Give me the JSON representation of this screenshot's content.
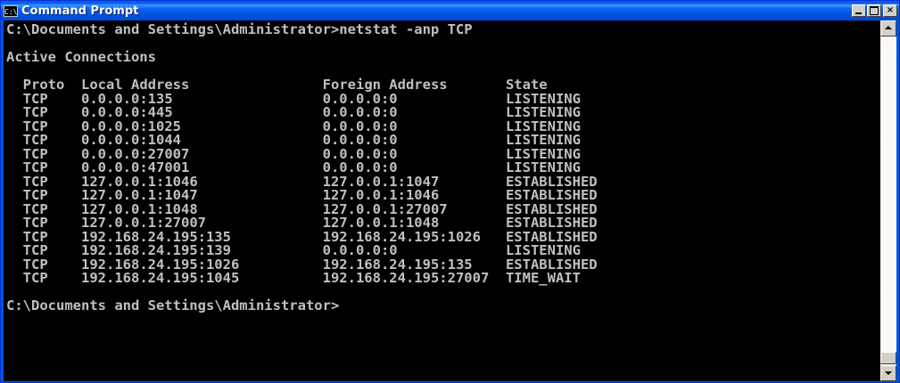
{
  "window": {
    "title": "Command Prompt",
    "icon_text": "C:\\",
    "minimize_icon": "minimize-icon",
    "maximize_icon": "maximize-icon",
    "close_label": "×"
  },
  "console": {
    "command_line": "C:\\Documents and Settings\\Administrator>netstat -anp TCP",
    "heading": "Active Connections",
    "columns": [
      "Proto",
      "Local Address",
      "Foreign Address",
      "State"
    ],
    "rows": [
      [
        "TCP",
        "0.0.0.0:135",
        "0.0.0.0:0",
        "LISTENING"
      ],
      [
        "TCP",
        "0.0.0.0:445",
        "0.0.0.0:0",
        "LISTENING"
      ],
      [
        "TCP",
        "0.0.0.0:1025",
        "0.0.0.0:0",
        "LISTENING"
      ],
      [
        "TCP",
        "0.0.0.0:1044",
        "0.0.0.0:0",
        "LISTENING"
      ],
      [
        "TCP",
        "0.0.0.0:27007",
        "0.0.0.0:0",
        "LISTENING"
      ],
      [
        "TCP",
        "0.0.0.0:47001",
        "0.0.0.0:0",
        "LISTENING"
      ],
      [
        "TCP",
        "127.0.0.1:1046",
        "127.0.0.1:1047",
        "ESTABLISHED"
      ],
      [
        "TCP",
        "127.0.0.1:1047",
        "127.0.0.1:1046",
        "ESTABLISHED"
      ],
      [
        "TCP",
        "127.0.0.1:1048",
        "127.0.0.1:27007",
        "ESTABLISHED"
      ],
      [
        "TCP",
        "127.0.0.1:27007",
        "127.0.0.1:1048",
        "ESTABLISHED"
      ],
      [
        "TCP",
        "192.168.24.195:135",
        "192.168.24.195:1026",
        "ESTABLISHED"
      ],
      [
        "TCP",
        "192.168.24.195:139",
        "0.0.0.0:0",
        "LISTENING"
      ],
      [
        "TCP",
        "192.168.24.195:1026",
        "192.168.24.195:135",
        "ESTABLISHED"
      ],
      [
        "TCP",
        "192.168.24.195:1045",
        "192.168.24.195:27007",
        "TIME_WAIT"
      ]
    ],
    "prompt": "C:\\Documents and Settings\\Administrator>"
  },
  "colors": {
    "titlebar": "#0054e3",
    "console_bg": "#000000",
    "console_text": "#c0c0c0"
  }
}
